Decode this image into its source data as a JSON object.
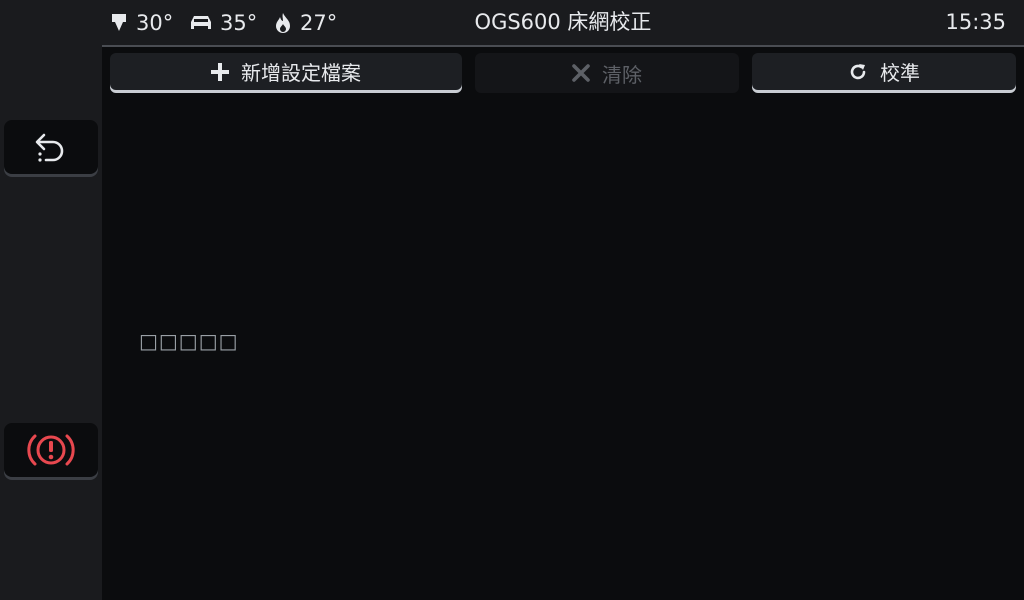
{
  "status_bar": {
    "temps": [
      {
        "icon": "nozzle-icon",
        "value": "30°"
      },
      {
        "icon": "bed-icon",
        "value": "35°"
      },
      {
        "icon": "flame-icon",
        "value": "27°"
      }
    ],
    "title": "OGS600 床網校正",
    "time": "15:35"
  },
  "sidebar": {
    "back_icon": "back-arrow-icon",
    "estop_icon": "emergency-stop-icon",
    "estop_color": "#e8484f"
  },
  "toolbar": {
    "add_label": "新增設定檔案",
    "clear_label": "清除",
    "calibrate_label": "校準"
  },
  "main": {
    "empty_text": "□□□□□"
  }
}
